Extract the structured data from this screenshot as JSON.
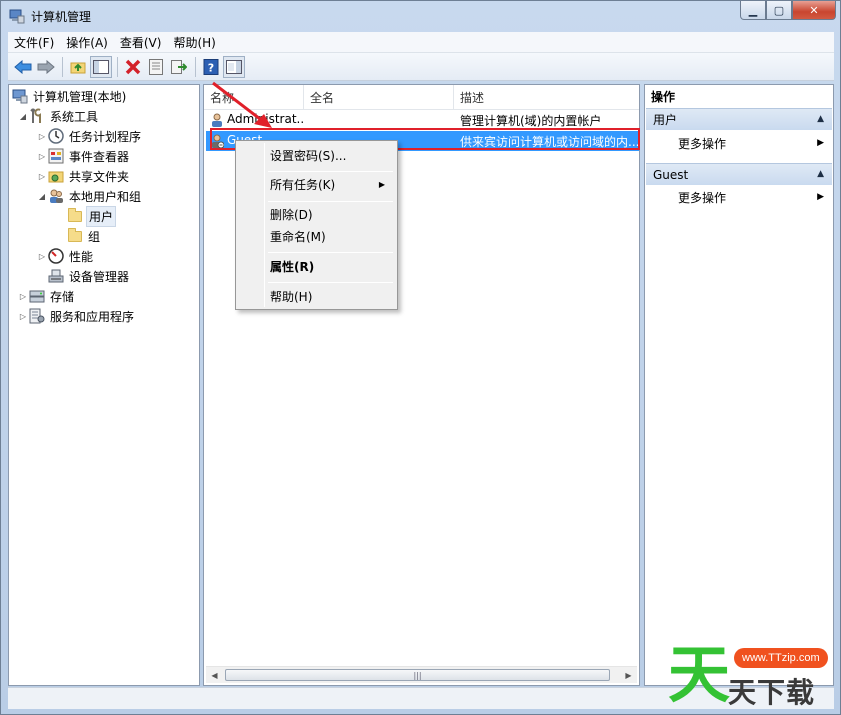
{
  "window": {
    "title": "计算机管理",
    "buttons": {
      "minimize": "▁",
      "maximize": "▢",
      "close": "✕"
    }
  },
  "menubar": [
    "文件(F)",
    "操作(A)",
    "查看(V)",
    "帮助(H)"
  ],
  "toolbar": {
    "icons": [
      "back-arrow-icon",
      "forward-arrow-icon",
      "up-folder-icon",
      "show-hide-tree-icon",
      "delete-icon",
      "properties-icon",
      "export-list-icon",
      "help-icon",
      "show-action-pane-icon"
    ]
  },
  "tree": {
    "root": "计算机管理(本地)",
    "system_tools": "系统工具",
    "task_scheduler": "任务计划程序",
    "event_viewer": "事件查看器",
    "shared_folders": "共享文件夹",
    "local_users_groups": "本地用户和组",
    "users": "用户",
    "groups": "组",
    "performance": "性能",
    "device_manager": "设备管理器",
    "storage": "存储",
    "services_apps": "服务和应用程序"
  },
  "list": {
    "columns": [
      "名称",
      "全名",
      "描述"
    ],
    "rows": [
      {
        "name": "Administrat...",
        "fullname": "",
        "description": "管理计算机(域)的内置帐户"
      },
      {
        "name": "Guest",
        "fullname": "",
        "description": "供来宾访问计算机或访问域的内..."
      }
    ]
  },
  "context_menu": {
    "set_password": "设置密码(S)...",
    "all_tasks": "所有任务(K)",
    "delete": "删除(D)",
    "rename": "重命名(M)",
    "properties": "属性(R)",
    "help": "帮助(H)"
  },
  "actions": {
    "title": "操作",
    "section1": "用户",
    "section1_more": "更多操作",
    "section2": "Guest",
    "section2_more": "更多操作"
  },
  "watermark": {
    "url": "www.TTzip.com",
    "char_main": "天",
    "text": "天下载"
  },
  "colors": {
    "selection": "#3399ff",
    "highlight_border": "#e0202a",
    "action_header": "#c9daef"
  }
}
